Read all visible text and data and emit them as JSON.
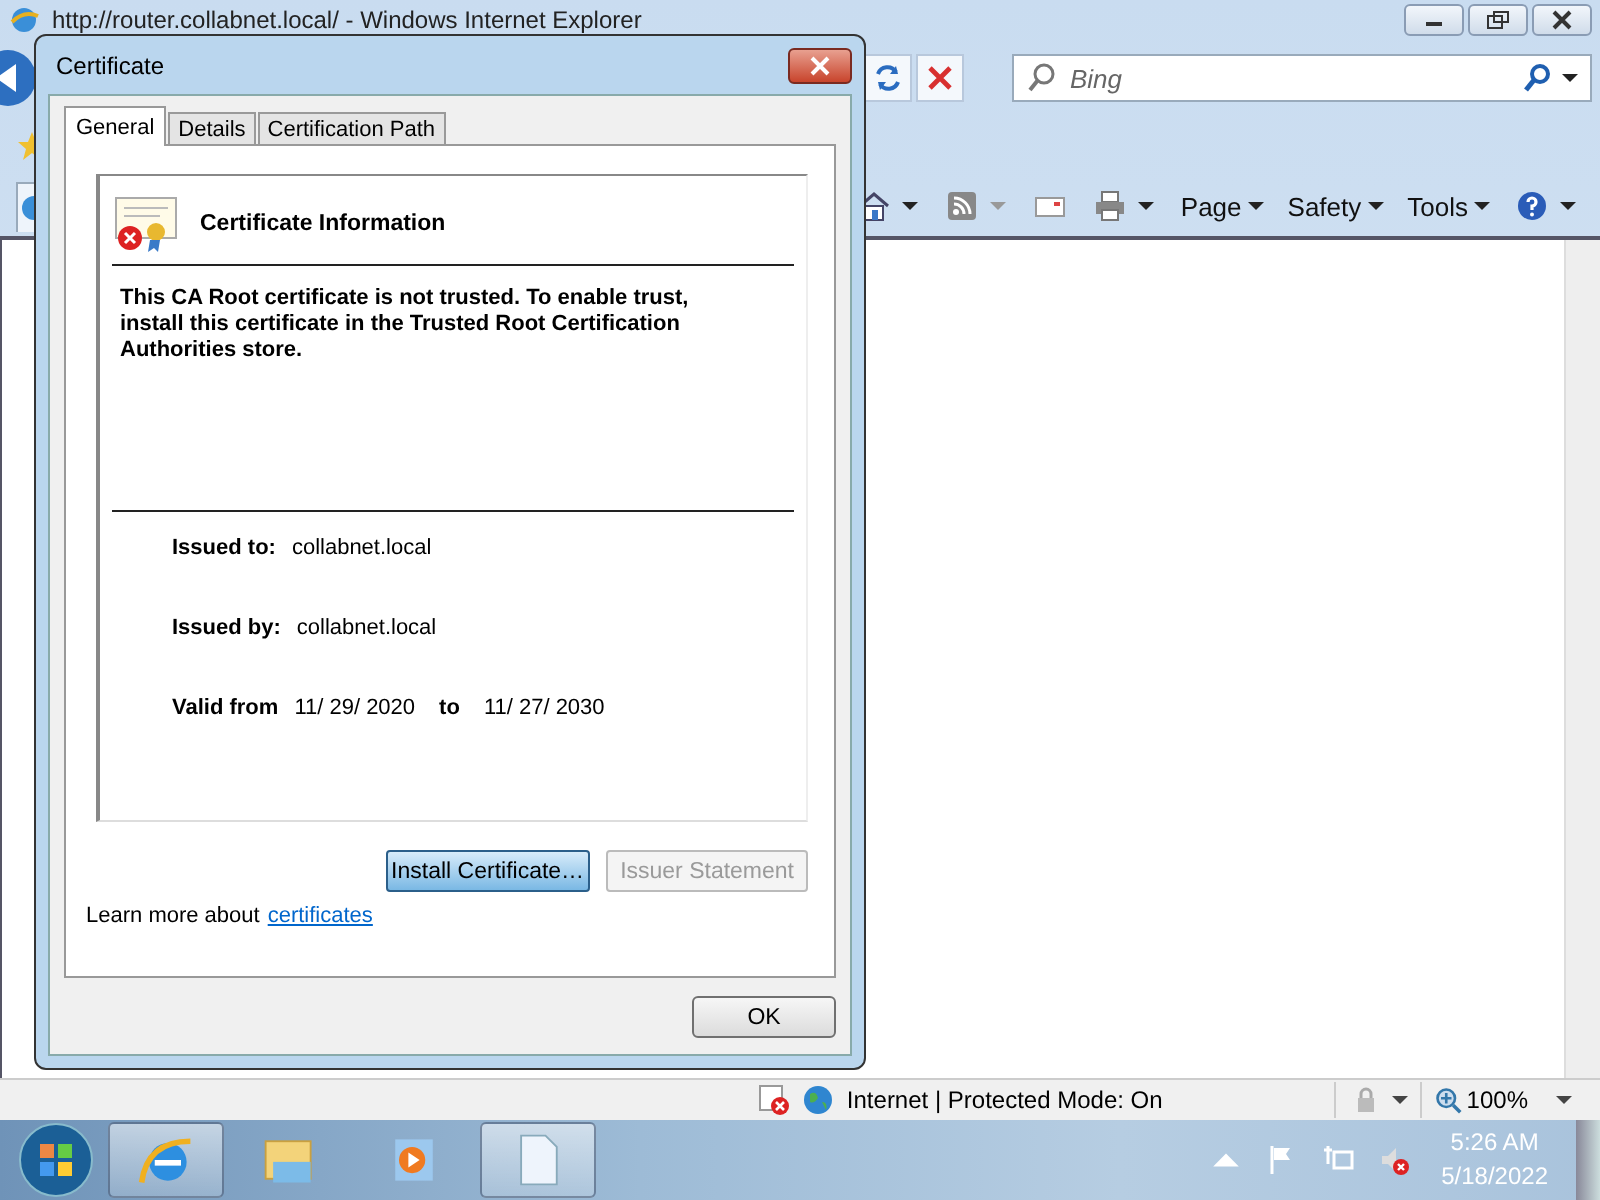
{
  "browser": {
    "title": "http://router.collabnet.local/ - Windows Internet Explorer",
    "search": {
      "placeholder": "Bing"
    },
    "menus": [
      "Page",
      "Safety",
      "Tools"
    ]
  },
  "status_bar": {
    "zone": "Internet | Protected Mode: On",
    "zoom": "100%"
  },
  "taskbar": {
    "apps": [
      {
        "kind": "browser",
        "active": true
      },
      {
        "kind": "folder",
        "active": false
      },
      {
        "kind": "media",
        "active": false
      },
      {
        "kind": "document",
        "active": true
      }
    ],
    "time": "5:26 AM",
    "date": "5/18/2022"
  },
  "dialog": {
    "title": "Certificate",
    "tabs": [
      {
        "label": "General",
        "selected": true
      },
      {
        "label": "Details",
        "selected": false
      },
      {
        "label": "Certification Path",
        "selected": false
      }
    ],
    "heading": "Certificate Information",
    "message": "This CA Root certificate is not trusted. To enable trust, install this certificate in the Trusted Root Certification Authorities store.",
    "fields": [
      {
        "label": "Issued to:",
        "value": "collabnet.local"
      },
      {
        "label": "Issued by:",
        "value": "collabnet.local"
      }
    ],
    "validity": {
      "label": "Valid from",
      "from": "11/ 29/ 2020",
      "to_label": "to",
      "to": "11/ 27/ 2030"
    },
    "buttons": [
      {
        "label": "Install Certificate…",
        "disabled": false,
        "focused": true
      },
      {
        "label": "Issuer Statement",
        "disabled": true,
        "focused": false
      }
    ],
    "learn_more": {
      "text": "Learn more about",
      "link": "certificates"
    },
    "ok": "OK"
  }
}
